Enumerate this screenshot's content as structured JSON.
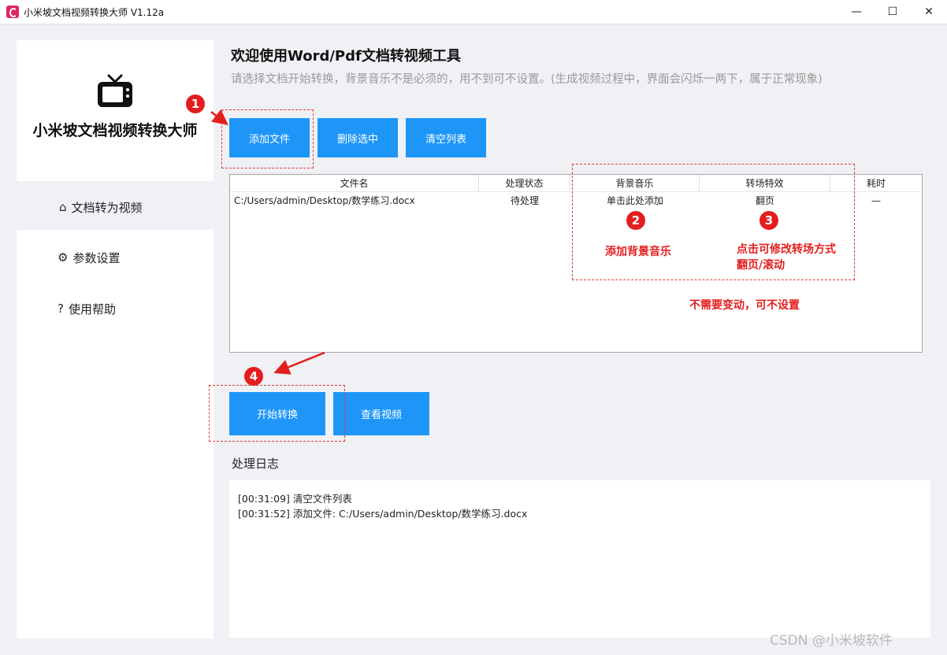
{
  "window": {
    "title": "小米坡文档视频转换大师 V1.12a",
    "minimize": "—",
    "maximize": "☐",
    "close": "✕"
  },
  "sidebar": {
    "app_name": "小米坡文档视频转换大师",
    "items": [
      {
        "label": "文档转为视频",
        "icon": "home-icon",
        "glyph": "⌂"
      },
      {
        "label": "参数设置",
        "icon": "gear-icon",
        "glyph": "⚙"
      },
      {
        "label": "使用帮助",
        "icon": "question-icon",
        "glyph": "?"
      }
    ]
  },
  "header": {
    "title": "欢迎使用Word/Pdf文档转视频工具",
    "subtitle": "请选择文档开始转换，背景音乐不是必须的，用不到可不设置。(生成视频过程中，界面会闪烁一两下，属于正常现象)"
  },
  "toolbar": {
    "add_file": "添加文件",
    "delete_selected": "删除选中",
    "clear_list": "清空列表"
  },
  "table": {
    "columns": [
      "文件名",
      "处理状态",
      "背景音乐",
      "转场特效",
      "耗时"
    ],
    "rows": [
      {
        "file": "C:/Users/admin/Desktop/数学练习.docx",
        "status": "待处理",
        "music": "单击此处添加",
        "transition": "翻页",
        "time": "—"
      }
    ]
  },
  "annotations": {
    "badges": [
      "1",
      "2",
      "3",
      "4"
    ],
    "music_hint": "添加背景音乐",
    "transition_hint_1": "点击可修改转场方式",
    "transition_hint_2": "翻页/滚动",
    "optional_hint": "不需要变动，可不设置"
  },
  "actions": {
    "start": "开始转换",
    "view": "查看视频"
  },
  "log": {
    "title": "处理日志",
    "lines": [
      "[00:31:09] 清空文件列表",
      "[00:31:52] 添加文件: C:/Users/admin/Desktop/数学练习.docx"
    ]
  },
  "watermark": "CSDN @小米坡软件",
  "colors": {
    "accent": "#1e96f7",
    "annotation": "#e41e1e",
    "background": "#f0f1f5"
  }
}
